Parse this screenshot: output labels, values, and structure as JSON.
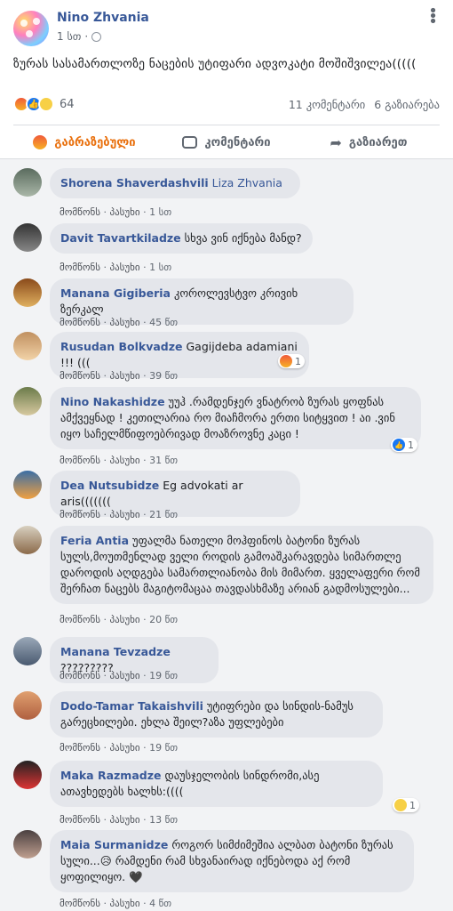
{
  "post": {
    "author": "Nino Zhvania",
    "time": "1 სთ",
    "more_icon": "more-horizontal-icon",
    "text": "ზურას სასამართლოზე ნაცების უტიფარი ადვოკატი მოშიშვილეა(((((",
    "reaction_count": "64",
    "comments_count": "11 კომენტარი",
    "shares_count": "6 გაზიარება",
    "reaction_icons": [
      "angry-icon",
      "like-icon",
      "sad-icon"
    ]
  },
  "actions": {
    "react_label": "გაბრაზებული",
    "comment_label": "კომენტარი",
    "share_label": "გაზიარეთ",
    "active_color": "#e9710f"
  },
  "comment_actions": {
    "like": "მომწონს",
    "reply": "პასუხი",
    "sep": "·"
  },
  "comments": [
    {
      "name": "Shorena Shaverdashvili",
      "tag": "Liza Zhvania",
      "text": "",
      "time": "1 სთ"
    },
    {
      "name": "Davit Tavartkiladze",
      "text": "სხვა ვინ იქნება მანდ?",
      "time": "1 სთ"
    },
    {
      "name": "Manana Gigiberia",
      "text": "კოროლევსტვო კრივიხ ზერკალ",
      "time": "45 წთ"
    },
    {
      "name": "Rusudan Bolkvadze",
      "text": "Gagijdeba adamiani !!! (((",
      "time": "39 წთ",
      "reaction": "1"
    },
    {
      "name": "Nino Nakashidze",
      "text": "უუჰ .რამდენჯერ ვნატრობ ზურას ყოფნას ამქვეყნად ! კეთილარია რო მიაჩმორა ერთი სიტყვით ! აი .ვინ იყო საჩელმწიფოებრივად მოაზროვნე კაცი !",
      "time": "31 წთ",
      "reaction": "1"
    },
    {
      "name": "Dea Nutsubidze",
      "text": "Eg advokati ar aris(((((((",
      "time": "21 წთ"
    },
    {
      "name": "Feria Antia",
      "text": "უფალმა ნათელი მოჰფინოს ბატონი ზურას სულს,მოუთმენლად ველი როდის გამოაშკარავდება სიმართლე დაროდის აღდგება სამართლიანობა მის მიმართ. ყველაფერი რომ შერჩათ ნაცებს მაგიტომაცაა თავდასხმაზე არიან გადმოსულები...",
      "time": "20 წთ"
    },
    {
      "name": "Manana Tevzadze",
      "text": "?????????",
      "time": "19 წთ"
    },
    {
      "name": "Dodo-Tamar Takaishvili",
      "text": "უტიფრები და სინდის-ნამუს გარეცხილები. ეხლა შეილ?აზა უფლებები",
      "time": "19 წთ"
    },
    {
      "name": "Maka Razmadze",
      "text": "დაუსჯელობის სინდრომი,ასე ათავხედებს ხალხს:((((",
      "time": "13 წთ",
      "reaction": "1"
    },
    {
      "name": "Maia Surmanidze",
      "text": "როგორ სიმძიმეშია ალბათ ბატონი ზურას სული...😥 რამდენი რამ სხვანაირად იქნებოდა აქ რომ ყოფილიყო. 🖤",
      "time": "4 წთ"
    }
  ]
}
